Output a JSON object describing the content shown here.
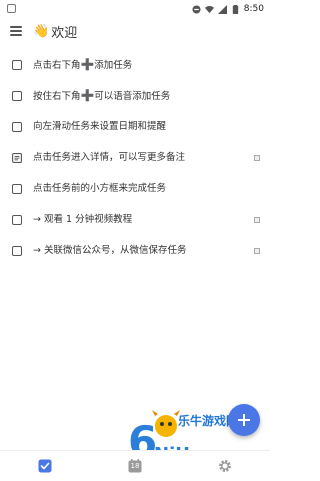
{
  "status_bar": {
    "time": "8:50",
    "icons": [
      "notification-square-icon",
      "do-not-disturb-icon",
      "wifi-icon",
      "signal-icon",
      "battery-icon"
    ]
  },
  "app_bar": {
    "title": "欢迎",
    "title_emoji": "👋"
  },
  "tasks": [
    {
      "pre": "点击右下角",
      "plus": "➕",
      "post": "添加任务",
      "icon": "checkbox",
      "has_note": false
    },
    {
      "pre": "按住右下角",
      "plus": "➕",
      "post": "可以语音添加任务",
      "icon": "checkbox",
      "has_note": false
    },
    {
      "pre": "向左滑动任务来设置日期和提醒",
      "plus": "",
      "post": "",
      "icon": "checkbox",
      "has_note": false
    },
    {
      "pre": "点击任务进入详情，可以写更多备注",
      "plus": "",
      "post": "",
      "icon": "note",
      "has_note": true
    },
    {
      "pre": "点击任务前的小方框来完成任务",
      "plus": "",
      "post": "",
      "icon": "checkbox",
      "has_note": false
    },
    {
      "pre": "→ 观看 1 分钟视频教程",
      "plus": "",
      "post": "",
      "icon": "checkbox",
      "has_note": true
    },
    {
      "pre": "→ 关联微信公众号，从微信保存任务",
      "plus": "",
      "post": "",
      "icon": "checkbox",
      "has_note": true
    }
  ],
  "bottom_nav": {
    "calendar_day": "18",
    "items": [
      "todo-check-icon",
      "calendar-icon",
      "settings-gear-icon"
    ]
  },
  "watermark": {
    "text": "乐牛游戏网"
  },
  "colors": {
    "accent": "#4a76e6",
    "plus": "#f07b3f",
    "nav_active": "#4a76e6",
    "nav_inactive": "#9a9a9a"
  }
}
